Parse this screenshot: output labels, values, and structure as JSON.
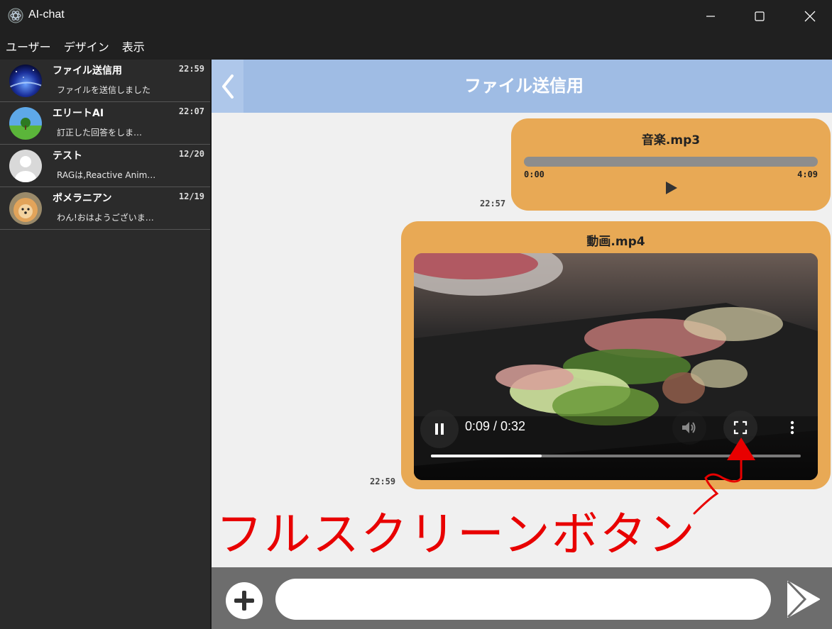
{
  "window": {
    "title": "AI-chat"
  },
  "menu": [
    "ユーザー",
    "デザイン",
    "表示"
  ],
  "sidebar": {
    "chats": [
      {
        "name": "ファイル送信用",
        "time": "22:59",
        "preview": "ファイルを送信しました"
      },
      {
        "name": "エリートAI",
        "time": "22:07",
        "preview": "訂正した回答をしま…"
      },
      {
        "name": "テスト",
        "time": "12/20",
        "preview": "RAGは,Reactive Anim…"
      },
      {
        "name": "ポメラニアン",
        "time": "12/19",
        "preview": "わん!おはようございま…"
      }
    ]
  },
  "header": {
    "title": "ファイル送信用"
  },
  "messages": {
    "audio": {
      "file_name": "音楽.mp3",
      "current": "0:00",
      "duration": "4:09",
      "progress": 0,
      "sent_time": "22:57"
    },
    "video": {
      "file_name": "動画.mp4",
      "time_display": "0:09 / 0:32",
      "progress": 0.3,
      "sent_time": "22:59"
    }
  },
  "annotation": {
    "text": "フルスクリーンボタン",
    "color": "#e80000"
  },
  "input": {
    "placeholder": "",
    "value": ""
  },
  "colors": {
    "header_bg": "#9fbce4",
    "bubble_bg": "#e8a955",
    "sidebar_bg": "#2b2b2b"
  }
}
